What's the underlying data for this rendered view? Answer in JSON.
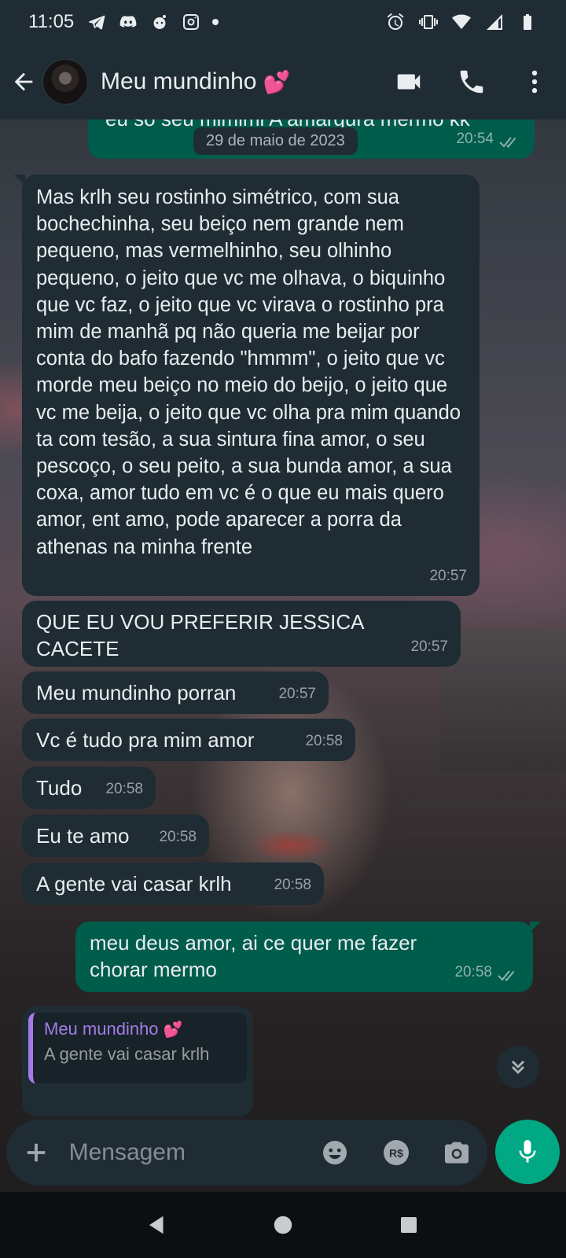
{
  "status_bar": {
    "time": "11:05",
    "left_icons": [
      "telegram-icon",
      "discord-icon",
      "reddit-icon",
      "instagram-icon",
      "notification-dot"
    ],
    "right_icons": [
      "alarm-icon",
      "vibrate-icon",
      "wifi-icon",
      "signal-icon",
      "battery-icon"
    ]
  },
  "header": {
    "contact_name": "Meu mundinho",
    "contact_emoji": "💕",
    "actions": [
      "video-call-icon",
      "phone-icon",
      "more-vert-icon"
    ]
  },
  "chat": {
    "partial_top_message": {
      "text": "eu so seu mimimi A amargura mermo kk",
      "time": "20:54",
      "status": "read"
    },
    "date_chip": "29 de maio de 2023",
    "messages": [
      {
        "direction": "in",
        "text": "Mas krlh seu rostinho simétrico, com sua bochechinha, seu beiço nem grande nem pequeno, mas vermelhinho, seu olhinho pequeno, o jeito que vc me olhava, o biquinho que vc faz, o jeito que vc virava o rostinho pra mim de manhã pq não queria me beijar por conta do bafo fazendo \"hmmm\", o jeito que vc morde meu beiço no meio do beijo, o jeito que vc me beija, o jeito que vc olha pra mim quando ta com tesão, a sua sintura fina amor, o seu pescoço, o seu peito, a sua bunda amor, a sua coxa, amor tudo em vc é o que eu mais quero amor, ent amo, pode aparecer a porra da athenas na minha frente",
        "time": "20:57"
      },
      {
        "direction": "in",
        "text": "QUE EU VOU PREFERIR JESSICA CACETE",
        "time": "20:57"
      },
      {
        "direction": "in",
        "text": "Meu mundinho porran",
        "time": "20:57"
      },
      {
        "direction": "in",
        "text": "Vc é tudo pra mim amor",
        "time": "20:58"
      },
      {
        "direction": "in",
        "text": "Tudo",
        "time": "20:58"
      },
      {
        "direction": "in",
        "text": "Eu te amo",
        "time": "20:58"
      },
      {
        "direction": "in",
        "text": "A gente vai casar krlh",
        "time": "20:58"
      },
      {
        "direction": "out",
        "text": "meu deus amor, ai ce quer me fazer chorar mermo",
        "time": "20:58",
        "status": "read"
      }
    ],
    "reply_preview": {
      "author": "Meu mundinho",
      "author_emoji": "💕",
      "quoted_text": "A gente vai casar krlh"
    }
  },
  "input": {
    "placeholder": "Mensagem",
    "value": "",
    "icons": [
      "plus-icon",
      "emoji-icon",
      "payment-icon",
      "camera-icon",
      "mic-icon"
    ],
    "payment_label": "R$"
  },
  "nav": [
    "back-triangle-icon",
    "home-circle-icon",
    "recents-square-icon"
  ],
  "colors": {
    "header_bg": "#1f2c34",
    "incoming_bubble": "#1f2c34",
    "outgoing_bubble": "#005c4b",
    "accent": "#00a884",
    "quote_author": "#a57ce6"
  }
}
